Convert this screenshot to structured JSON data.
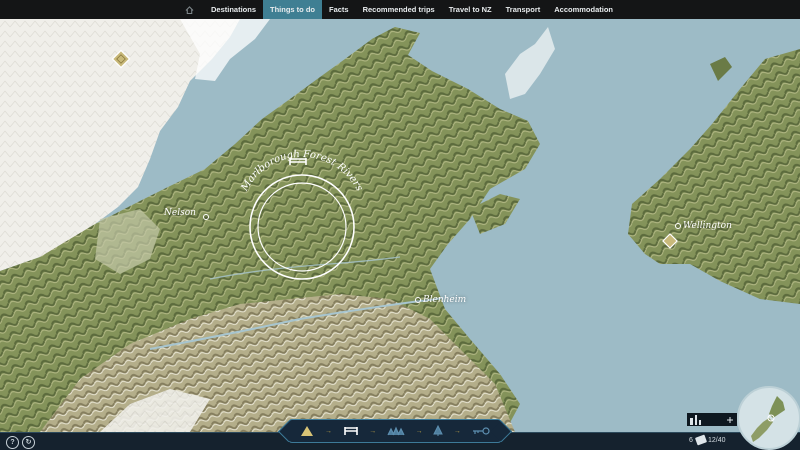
{
  "nav": {
    "home_icon": "home-icon",
    "items": [
      {
        "label": "Destinations",
        "active": false
      },
      {
        "label": "Things to do",
        "active": true
      },
      {
        "label": "Facts",
        "active": false
      },
      {
        "label": "Recommended trips",
        "active": false
      },
      {
        "label": "Travel to NZ",
        "active": false
      },
      {
        "label": "Transport",
        "active": false
      },
      {
        "label": "Accommodation",
        "active": false
      }
    ],
    "active_color": "#3f7f93"
  },
  "map": {
    "places": {
      "nelson": "Nelson",
      "blenheim": "Blenheim",
      "wellington": "Wellington"
    },
    "feature": {
      "label": "Marlborough Forest Rivers",
      "icon": "bridge-icon"
    },
    "colors": {
      "sea": "#9dbbc6",
      "land_green": "#7e8f55",
      "land_light": "#c9c5a6",
      "snow": "#f1f0ec"
    }
  },
  "bottom": {
    "help_icon": "help-icon",
    "share_icon": "share-icon",
    "activities": [
      {
        "icon": "mountain-icon"
      },
      {
        "icon": "bridge-icon"
      },
      {
        "icon": "forest-icon"
      },
      {
        "icon": "tree-icon"
      },
      {
        "icon": "key-icon"
      }
    ],
    "left_count": "6",
    "right_count": "12/40",
    "minimap_icon": "new-zealand-minimap"
  }
}
